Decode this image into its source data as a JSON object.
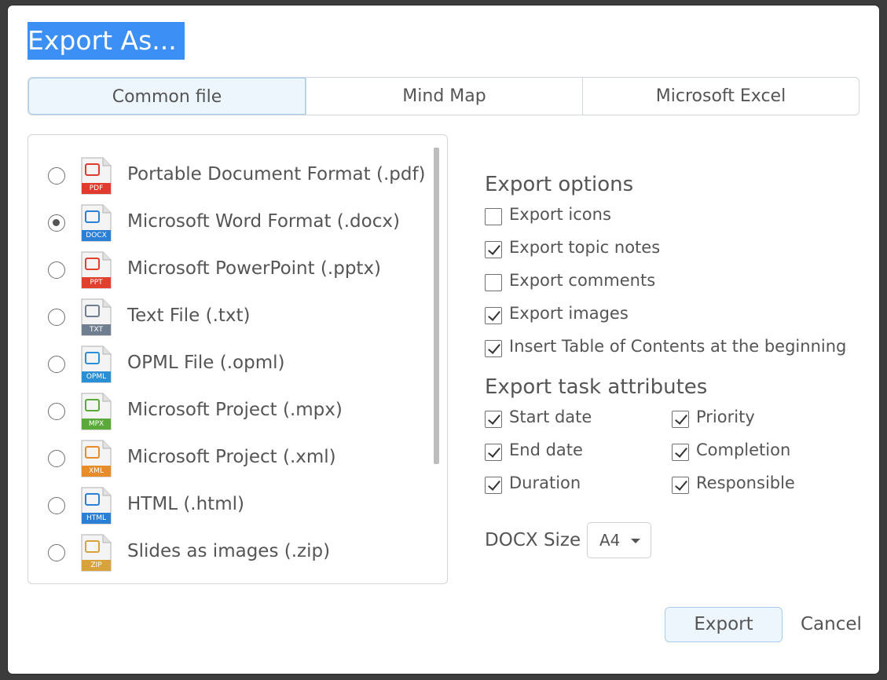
{
  "dialog": {
    "title": "Export As..."
  },
  "tabs": [
    "Common file",
    "Mind Map",
    "Microsoft Excel"
  ],
  "formats": [
    {
      "label": "Portable Document Format (.pdf)",
      "icon_text": "PDF",
      "icon": "pdf-file-icon",
      "checked": false
    },
    {
      "label": "Microsoft Word Format (.docx)",
      "icon_text": "DOCX",
      "icon": "docx-file-icon",
      "checked": true
    },
    {
      "label": "Microsoft PowerPoint (.pptx)",
      "icon_text": "PPT",
      "icon": "pptx-file-icon",
      "checked": false
    },
    {
      "label": "Text File (.txt)",
      "icon_text": "TXT",
      "icon": "txt-file-icon",
      "checked": false
    },
    {
      "label": "OPML File (.opml)",
      "icon_text": "OPML",
      "icon": "opml-file-icon",
      "checked": false
    },
    {
      "label": "Microsoft Project (.mpx)",
      "icon_text": "MPX",
      "icon": "mpx-file-icon",
      "checked": false
    },
    {
      "label": "Microsoft Project (.xml)",
      "icon_text": "XML",
      "icon": "xml-file-icon",
      "checked": false
    },
    {
      "label": "HTML (.html)",
      "icon_text": "HTML",
      "icon": "html-file-icon",
      "checked": false
    },
    {
      "label": "Slides as images (.zip)",
      "icon_text": "ZIP",
      "icon": "zip-file-icon",
      "checked": false
    }
  ],
  "export_options": {
    "heading": "Export options",
    "items": [
      {
        "label": "Export icons",
        "checked": false
      },
      {
        "label": "Export topic notes",
        "checked": true
      },
      {
        "label": "Export comments",
        "checked": false
      },
      {
        "label": "Export images",
        "checked": true
      },
      {
        "label": "Insert Table of Contents at the beginning",
        "checked": true
      }
    ]
  },
  "task_attributes": {
    "heading": "Export task attributes",
    "items": [
      {
        "label": "Start date",
        "checked": true
      },
      {
        "label": "Priority",
        "checked": true
      },
      {
        "label": "End date",
        "checked": true
      },
      {
        "label": "Completion",
        "checked": true
      },
      {
        "label": "Duration",
        "checked": true
      },
      {
        "label": "Responsible",
        "checked": true
      }
    ]
  },
  "docx_size": {
    "label": "DOCX Size",
    "value": "A4"
  },
  "buttons": {
    "export": "Export",
    "cancel": "Cancel"
  },
  "colors": {
    "accent": "#3b8ff5",
    "pdf": "#e03b2e",
    "docx": "#2b7fd4",
    "pptx": "#e0402d",
    "txt": "#6f7f8f",
    "opml": "#2b8fd6",
    "mpx": "#5ca93b",
    "xml": "#e88b2a",
    "html": "#2b7fd4",
    "zip": "#d9a33b"
  }
}
